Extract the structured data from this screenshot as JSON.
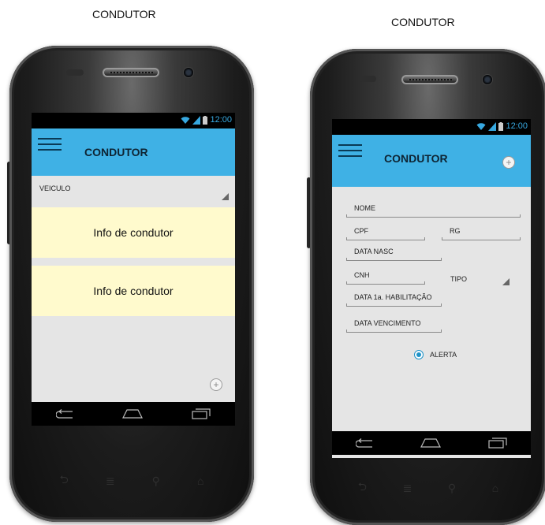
{
  "captions": {
    "left": "CONDUTOR",
    "right": "CONDUTOR"
  },
  "left_phone": {
    "status_time": "12:00",
    "appbar_title": "CONDUTOR",
    "veiculo_label": "VEICULO",
    "cards": [
      "Info de condutor",
      "Info de condutor"
    ]
  },
  "right_phone": {
    "status_time": "12:00",
    "appbar_title": "CONDUTOR",
    "fields": {
      "nome": "NOME",
      "cpf": "CPF",
      "rg": "RG",
      "data_nasc": "DATA NASC",
      "cnh": "CNH",
      "tipo": "TIPO",
      "data_habilitacao": "DATA 1a. HABILITAÇÃO",
      "data_vencimento": "DATA VENCIMENTO"
    },
    "alerta_label": "ALERTA",
    "alerta_checked": true
  },
  "colors": {
    "appbar": "#3fb1e5",
    "card": "#fffacd",
    "screen_bg": "#e5e5e5",
    "radio_accent": "#1f93c8"
  },
  "icons": [
    "menu-icon",
    "wifi-icon",
    "signal-icon",
    "battery-icon",
    "add-circle-icon",
    "dropdown-triangle-icon",
    "back-icon",
    "home-icon",
    "recents-icon",
    "search-icon"
  ]
}
